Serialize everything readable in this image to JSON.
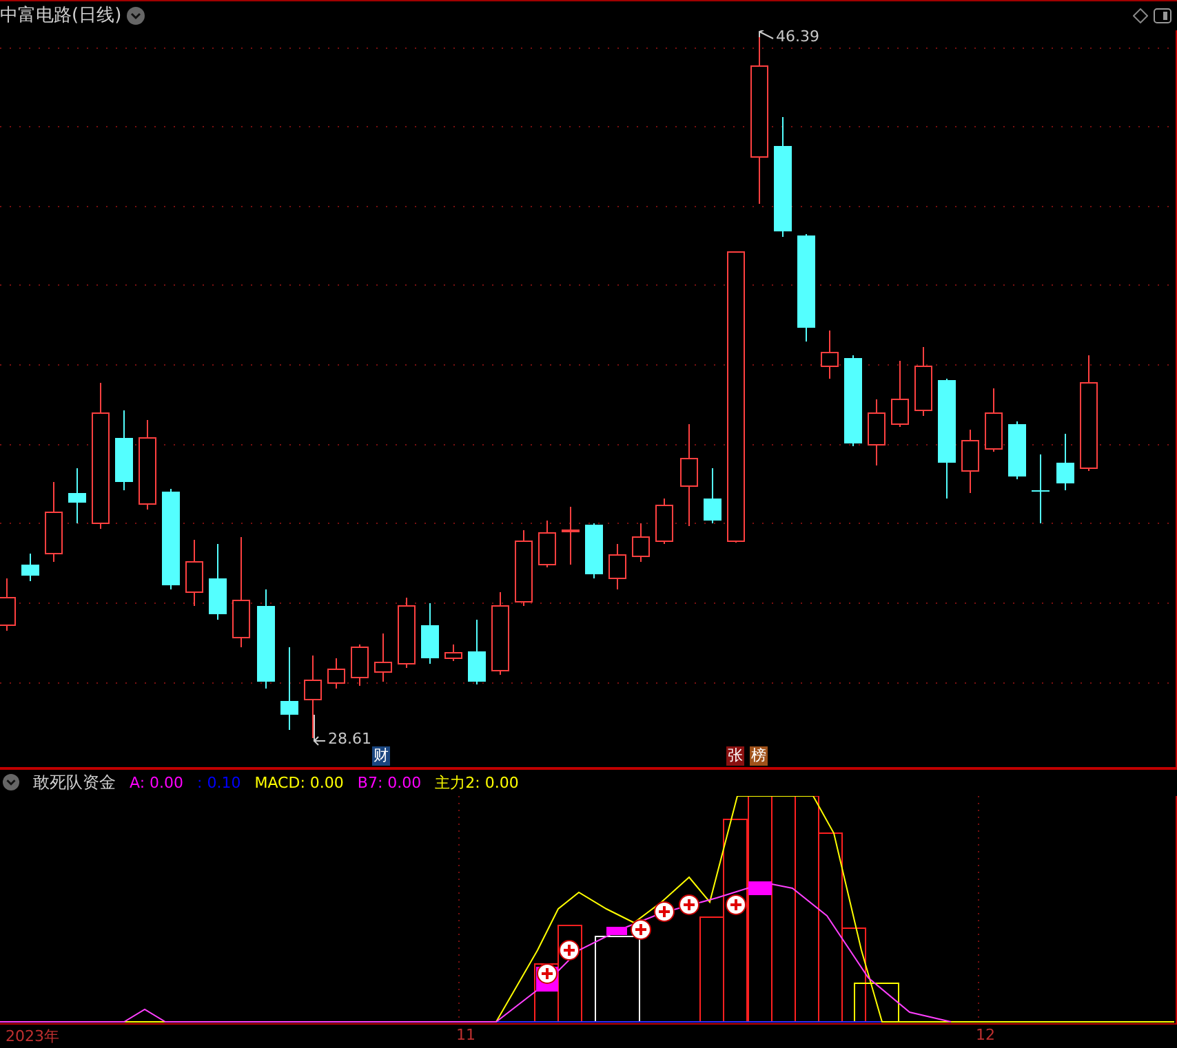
{
  "title": "中富电路(日线)",
  "price_marks": [
    {
      "kind": "low",
      "text": "28.61"
    },
    {
      "kind": "high",
      "text": "46.39"
    }
  ],
  "badges": [
    {
      "text": "财",
      "color": "#1a4680"
    },
    {
      "text": "张",
      "color": "#8a1010"
    },
    {
      "text": "榜",
      "color": "#a0521a"
    }
  ],
  "indicator": {
    "name": "敢死队资金",
    "values": [
      {
        "text": "A: 0.00",
        "color": "#ff00ff"
      },
      {
        "text": ": 0.10",
        "color": "#0000ff"
      },
      {
        "text": "MACD: 0.00",
        "color": "#ffff00"
      },
      {
        "text": "B7: 0.00",
        "color": "#ff00ff"
      },
      {
        "text": "主力2: 0.00",
        "color": "#ffff00"
      }
    ]
  },
  "x_axis": [
    "2023年",
    "11",
    "12"
  ]
}
